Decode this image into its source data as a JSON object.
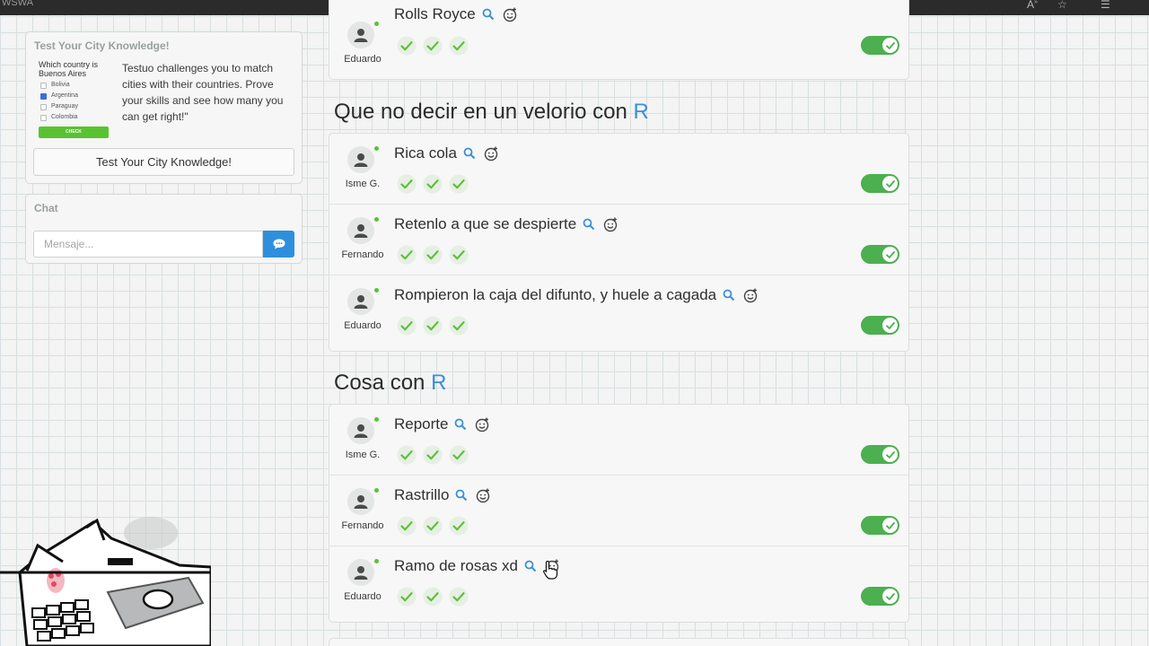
{
  "browser": {
    "tab_title": "WSWA",
    "icons": [
      "text-size-icon",
      "star-icon",
      "favorites-icon"
    ]
  },
  "sidebar": {
    "quiz": {
      "title": "Test Your City Knowledge!",
      "mini_question": "Which country is Buenos Aires",
      "mini_options": [
        {
          "label": "Bolivia",
          "checked": false
        },
        {
          "label": "Argentina",
          "checked": true
        },
        {
          "label": "Paraguay",
          "checked": false
        },
        {
          "label": "Colombia",
          "checked": false
        }
      ],
      "mini_button": "CHECK",
      "description": "Testuo challenges you to match cities with their countries. Prove your skills and see how many you can get right!\"",
      "button_label": "Test Your City Knowledge!"
    },
    "chat": {
      "title": "Chat",
      "placeholder": "Mensaje...",
      "send_icon": "chat-bubble-icon"
    }
  },
  "top_group": {
    "rows": [
      {
        "answer": "Rolls Royce",
        "user": "Eduardo",
        "checks": 3,
        "valid": true
      }
    ]
  },
  "groups": [
    {
      "heading": "Que no decir en un velorio con",
      "letter": "R",
      "rows": [
        {
          "answer": "Rica cola",
          "user": "Isme G.",
          "checks": 3,
          "valid": true
        },
        {
          "answer": "Retenlo a que se despierte",
          "user": "Fernando",
          "checks": 3,
          "valid": true
        },
        {
          "answer": "Rompieron la caja del difunto, y huele a cagada",
          "user": "Eduardo",
          "checks": 3,
          "valid": true
        }
      ]
    },
    {
      "heading": "Cosa con",
      "letter": "R",
      "rows": [
        {
          "answer": "Reporte",
          "user": "Isme G.",
          "checks": 3,
          "valid": true
        },
        {
          "answer": "Rastrillo",
          "user": "Fernando",
          "checks": 3,
          "valid": true
        },
        {
          "answer": "Ramo de rosas xd",
          "user": "Eduardo",
          "checks": 3,
          "valid": true
        }
      ]
    }
  ],
  "colors": {
    "accent_blue": "#3a8fd9",
    "toggle_green": "#4caf50",
    "check_green": "#5fbf3a",
    "send_blue": "#2f8fdc"
  }
}
